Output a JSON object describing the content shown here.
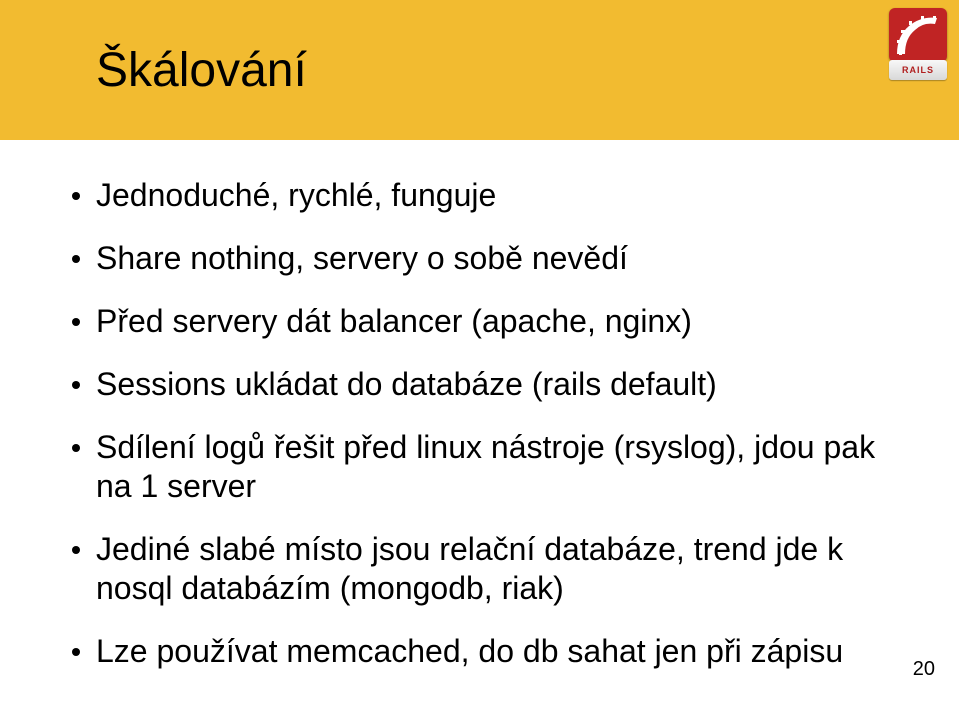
{
  "title": "Škálování",
  "logo": {
    "label": "RAILS"
  },
  "bullets": [
    "Jednoduché, rychlé, funguje",
    "Share nothing, servery o sobě nevědí",
    "Před servery dát balancer (apache, nginx)",
    "Sessions ukládat do databáze (rails default)",
    "Sdílení logů řešit před linux nástroje (rsyslog), jdou pak na 1 server",
    "Jediné slabé místo jsou relační databáze, trend jde k nosql databázím (mongodb, riak)",
    "Lze používat memcached, do db sahat jen při zápisu"
  ],
  "page_number": "20"
}
